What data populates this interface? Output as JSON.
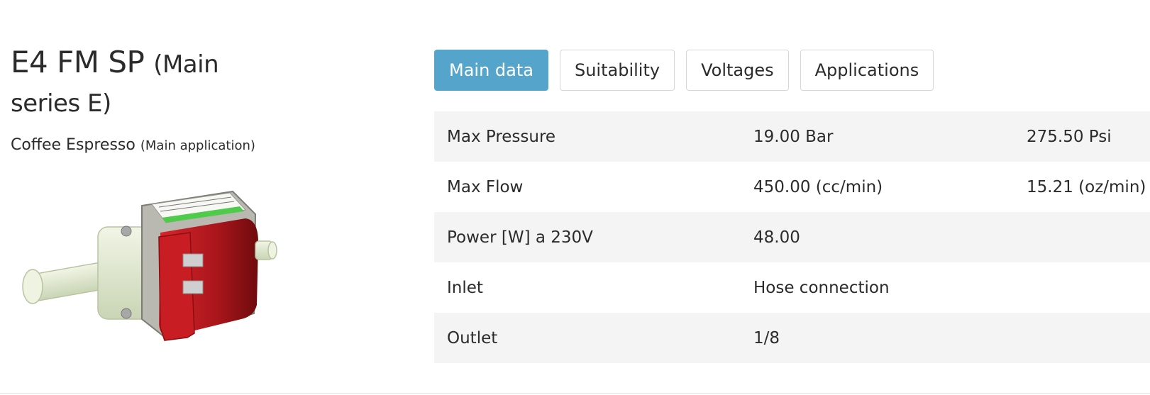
{
  "product": {
    "name": "E4 FM SP",
    "series_note": "(Main series E)",
    "application": "Coffee Espresso",
    "application_note": "(Main application)"
  },
  "tabs": [
    {
      "label": "Main data",
      "active": true
    },
    {
      "label": "Suitability",
      "active": false
    },
    {
      "label": "Voltages",
      "active": false
    },
    {
      "label": "Applications",
      "active": false
    }
  ],
  "specs": [
    {
      "label": "Max Pressure",
      "value1": "19.00 Bar",
      "value2": "275.50 Psi"
    },
    {
      "label": "Max Flow",
      "value1": "450.00 (cc/min)",
      "value2": "15.21 (oz/min)"
    },
    {
      "label": "Power [W] a 230V",
      "value1": "48.00",
      "value2": ""
    },
    {
      "label": "Inlet",
      "value1": "Hose connection",
      "value2": ""
    },
    {
      "label": "Outlet",
      "value1": "1/8",
      "value2": ""
    }
  ],
  "colors": {
    "accent": "#54a4cc",
    "row_alt": "#f4f4f4",
    "pump_body": "#b3191d",
    "pump_plastic": "#e4ecd6"
  }
}
